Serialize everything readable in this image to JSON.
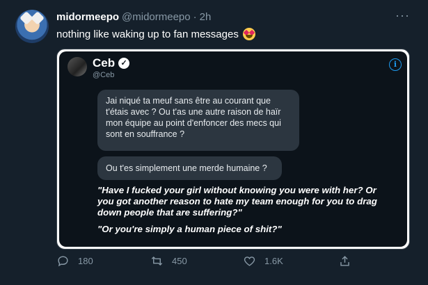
{
  "tweet": {
    "display_name": "midormeepo",
    "handle": "@midormeepo",
    "separator": "·",
    "time": "2h",
    "more_label": "···",
    "text": "nothing like waking up to fan messages",
    "emoji": "heart-eyes-emoji"
  },
  "quoted": {
    "name": "Ceb",
    "handle": "@Ceb",
    "verified": true,
    "info_label": "i",
    "message_1": "Jai niqué ta meuf sans être au courant que t'étais avec ? Ou t'as une autre raison de haïr mon équipe au point d'enfoncer des mecs qui sont en souffrance ?",
    "message_2": "Ou t'es simplement une merde humaine ?",
    "translation_1": "\"Have I fucked your girl without knowing you were with her? Or you got another reason to hate my team enough for you to drag down people that are suffering?\"",
    "translation_2": "\"Or you're simply a human piece of shit?\""
  },
  "actions": {
    "replies": "180",
    "retweets": "450",
    "likes": "1.6K"
  },
  "colors": {
    "background": "#15202b",
    "secondary_text": "#8899a6",
    "accent": "#1d9bf0"
  }
}
